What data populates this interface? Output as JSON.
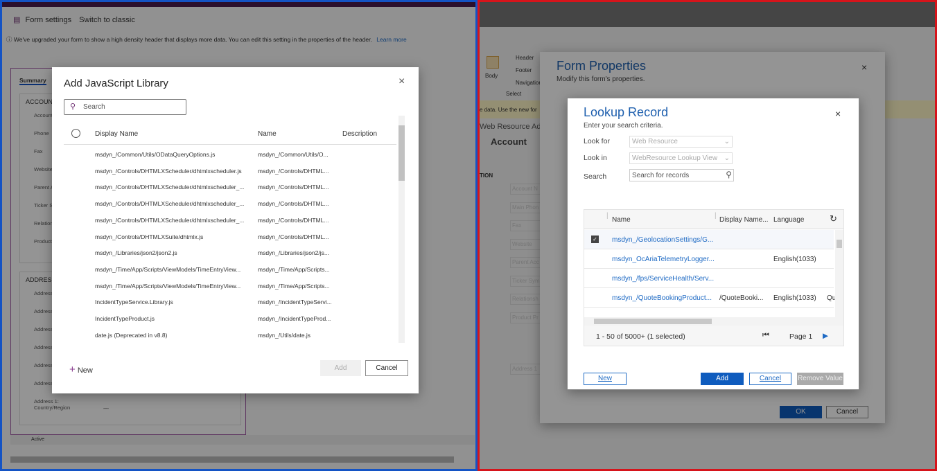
{
  "left": {
    "toolbar": {
      "form_settings": "Form settings",
      "switch_classic": "Switch to classic"
    },
    "info": {
      "text": "We've upgraded your form to show a high density header that displays more data. You can edit this setting in the properties of the header.",
      "link": "Learn more"
    },
    "tab": "Summary",
    "sections": {
      "account": "ACCOUNT",
      "address": "ADDRESS"
    },
    "account_fields": [
      "Account",
      "Phone",
      "Fax",
      "Website",
      "Parent A",
      "Ticker Sy",
      "Relations",
      "Product"
    ],
    "address_fields": [
      "Address",
      "Address",
      "Address",
      "Address",
      "Address State/Pr",
      "Address Code",
      "Address 1: Country/Region"
    ],
    "empty_value": "---",
    "status": "Active",
    "dialog": {
      "title": "Add JavaScript Library",
      "search_placeholder": "Search",
      "columns": [
        "Display Name",
        "Name",
        "Description"
      ],
      "rows": [
        [
          "msdyn_/Common/Utils/ODataQueryOptions.js",
          "msdyn_/Common/Utils/O..."
        ],
        [
          "msdyn_/Controls/DHTMLXScheduler/dhtmlxscheduler.js",
          "msdyn_/Controls/DHTML..."
        ],
        [
          "msdyn_/Controls/DHTMLXScheduler/dhtmlxscheduler_...",
          "msdyn_/Controls/DHTML..."
        ],
        [
          "msdyn_/Controls/DHTMLXScheduler/dhtmlxscheduler_...",
          "msdyn_/Controls/DHTML..."
        ],
        [
          "msdyn_/Controls/DHTMLXScheduler/dhtmlxscheduler_...",
          "msdyn_/Controls/DHTML..."
        ],
        [
          "msdyn_/Controls/DHTMLXSuite/dhtmlx.js",
          "msdyn_/Controls/DHTML..."
        ],
        [
          "msdyn_/Libraries/json2/json2.js",
          "msdyn_/Libraries/json2/js..."
        ],
        [
          "msdyn_/Time/App/Scripts/ViewModels/TimeEntryView...",
          "msdyn_/Time/App/Scripts..."
        ],
        [
          "msdyn_/Time/App/Scripts/ViewModels/TimeEntryView...",
          "msdyn_/Time/App/Scripts..."
        ],
        [
          "IncidentTypeService.Library.js",
          "msdyn_/IncidentTypeServi..."
        ],
        [
          "IncidentTypeProduct.js",
          "msdyn_/IncidentTypeProd..."
        ],
        [
          "date.js (Deprecated in v8.8)",
          "msdyn_/Utils/date.js"
        ]
      ],
      "new": "New",
      "add": "Add",
      "cancel": "Cancel"
    }
  },
  "right": {
    "ribbon": {
      "body": "Body",
      "header": "Header",
      "footer": "Footer",
      "navigation": "Navigation",
      "select": "Select"
    },
    "notice": "e data. Use the new for",
    "form_title": "Web Resource Ad",
    "entity": "Account",
    "section": "TION",
    "fields": [
      "Account N",
      "Main Phon",
      "Fax",
      "Website",
      "Parent Acc",
      "Ticker Sym",
      "Relationsh",
      "Product Pr",
      "Address 1"
    ],
    "form_properties": {
      "title": "Form Properties",
      "subtitle": "Modify this form's properties.",
      "ok": "OK",
      "cancel": "Cancel"
    },
    "lookup": {
      "title": "Lookup Record",
      "subtitle": "Enter your search criteria.",
      "look_for_label": "Look for",
      "look_for_value": "Web Resource",
      "look_in_label": "Look in",
      "look_in_value": "WebResource Lookup View",
      "search_label": "Search",
      "search_placeholder": "Search for records",
      "columns": [
        "Name",
        "Display Name...",
        "Language"
      ],
      "rows": [
        {
          "name": "msdyn_/GeolocationSettings/G...",
          "display": "",
          "language": "",
          "extra": "",
          "checked": true
        },
        {
          "name": "msdyn_OcAriaTelemetryLogger...",
          "display": "",
          "language": "English(1033)",
          "extra": "",
          "checked": false
        },
        {
          "name": "msdyn_/fps/ServiceHealth/Serv...",
          "display": "",
          "language": "",
          "extra": "",
          "checked": false
        },
        {
          "name": "msdyn_/QuoteBookingProduct...",
          "display": "/QuoteBooki...",
          "language": "English(1033)",
          "extra": "Qu",
          "checked": false
        }
      ],
      "count": "1 - 50 of 5000+ (1 selected)",
      "page": "Page 1",
      "new": "New",
      "add": "Add",
      "cancel": "Cancel",
      "remove": "Remove Value"
    }
  },
  "colors": {
    "left_frame": "#1453c4",
    "right_frame": "#d6141b",
    "accent": "#0f6cbd",
    "primary_button": "#0f5cbe"
  }
}
